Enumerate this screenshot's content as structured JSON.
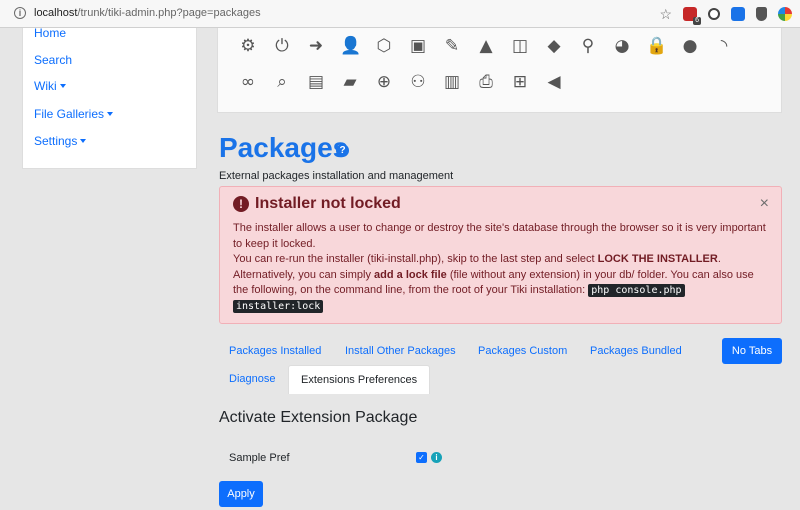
{
  "browser": {
    "url_host": "localhost",
    "url_path": "/trunk/tiki-admin.php?page=packages",
    "extension_badge": "6"
  },
  "sidebar": {
    "items": [
      {
        "label": "Home",
        "dropdown": false
      },
      {
        "label": "Search",
        "dropdown": false
      },
      {
        "label": "Wiki",
        "dropdown": true
      },
      {
        "label": "File Galleries",
        "dropdown": true
      },
      {
        "label": "Settings",
        "dropdown": true
      }
    ]
  },
  "toolbar": {
    "row1": [
      "gear-icon",
      "power-icon",
      "sign-in-icon",
      "user-icon",
      "cube-icon",
      "image-icon",
      "edit-icon",
      "shapes-icon",
      "language-icon",
      "tag-icon",
      "map-marker-icon",
      "palette-icon",
      "lock-icon",
      "comment-icon",
      "rss-icon"
    ],
    "row2": [
      "link-icon",
      "search-icon",
      "file-icon",
      "folder-open-icon",
      "zoom-in-icon",
      "users-icon",
      "chart-icon",
      "print-icon",
      "gift-icon",
      "bullhorn-icon"
    ]
  },
  "page": {
    "title": "Packages",
    "subtitle": "External packages installation and management"
  },
  "alert": {
    "title": "Installer not locked",
    "line1": "The installer allows a user to change or destroy the site's database through the browser so it is very important to keep it locked.",
    "line2_pre": "You can re-run the installer (tiki-install.php), skip to the last step and select ",
    "line2_strong": "LOCK THE INSTALLER",
    "line2_post": ".",
    "line3_pre": "Alternatively, you can simply ",
    "line3_strong": "add a lock file",
    "line3_post": " (file without any extension) in your db/ folder. You can also use the following, on the command line, from the root of your Tiki installation: ",
    "code1": "php console.php",
    "code2": "installer:lock"
  },
  "tabs": {
    "installed": "Packages Installed",
    "install_other": "Install Other Packages",
    "custom": "Packages Custom",
    "bundled": "Packages Bundled",
    "diagnose": "Diagnose",
    "ext_prefs": "Extensions Preferences",
    "no_tabs": "No Tabs"
  },
  "section": {
    "title": "Activate Extension Package",
    "pref_label": "Sample Pref",
    "pref_checked": true,
    "apply": "Apply"
  },
  "colors": {
    "accent": "#0d6efd",
    "title_blue": "#1a73e8",
    "alert_bg": "#f8d7da",
    "alert_text": "#721c24"
  }
}
